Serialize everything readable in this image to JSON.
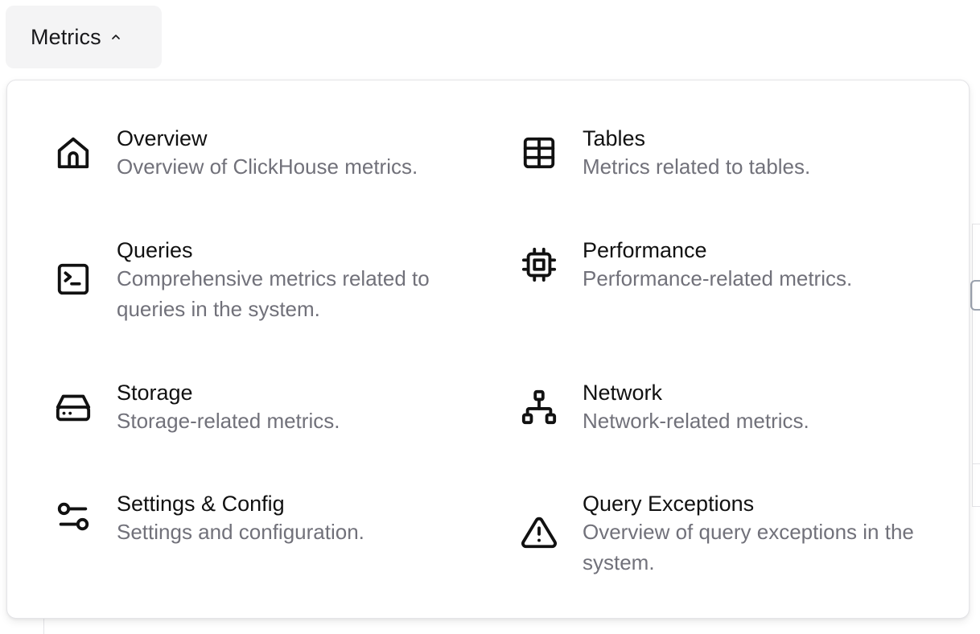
{
  "trigger": {
    "label": "Metrics",
    "icon": "chevron-up-icon"
  },
  "menu": {
    "items": [
      {
        "id": "overview",
        "title": "Overview",
        "description": "Overview of ClickHouse metrics.",
        "icon": "home-icon"
      },
      {
        "id": "tables",
        "title": "Tables",
        "description": "Metrics related to tables.",
        "icon": "table-icon"
      },
      {
        "id": "queries",
        "title": "Queries",
        "description": "Comprehensive metrics related to queries in the system.",
        "icon": "terminal-icon"
      },
      {
        "id": "performance",
        "title": "Performance",
        "description": "Performance-related metrics.",
        "icon": "cpu-icon"
      },
      {
        "id": "storage",
        "title": "Storage",
        "description": "Storage-related metrics.",
        "icon": "hard-drive-icon"
      },
      {
        "id": "network",
        "title": "Network",
        "description": "Network-related metrics.",
        "icon": "network-icon"
      },
      {
        "id": "settings",
        "title": "Settings & Config",
        "description": "Settings and configuration.",
        "icon": "sliders-icon"
      },
      {
        "id": "query-exceptions",
        "title": "Query Exceptions",
        "description": "Overview of query exceptions in the system.",
        "icon": "alert-triangle-icon"
      }
    ]
  }
}
